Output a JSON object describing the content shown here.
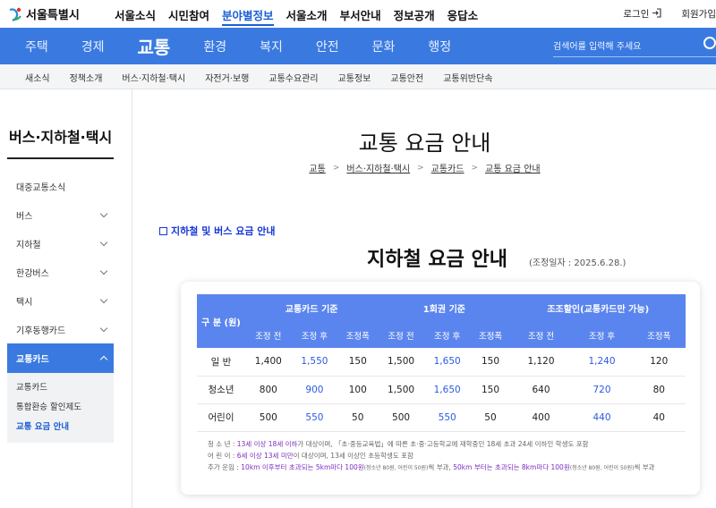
{
  "header": {
    "logo_text": "서울특별시",
    "top_nav": [
      "서울소식",
      "시민참여",
      "분야별정보",
      "서울소개",
      "부서안내",
      "정보공개",
      "응답소"
    ],
    "top_nav_active": 2,
    "login_label": "로그인",
    "signup_label": "회원가입"
  },
  "main_nav": {
    "items": [
      "주택",
      "경제",
      "교통",
      "환경",
      "복지",
      "안전",
      "문화",
      "행정"
    ],
    "active": 2,
    "search_placeholder": "검색어를 입력해 주세요"
  },
  "sub_nav": [
    "새소식",
    "정책소개",
    "버스·지하철·택시",
    "자전거·보행",
    "교통수요관리",
    "교통정보",
    "교통안전",
    "교통위반단속"
  ],
  "sidebar": {
    "title": "버스·지하철·택시",
    "items": [
      {
        "label": "대중교통소식",
        "has_chevron": false
      },
      {
        "label": "버스",
        "has_chevron": true
      },
      {
        "label": "지하철",
        "has_chevron": true
      },
      {
        "label": "한강버스",
        "has_chevron": true
      },
      {
        "label": "택시",
        "has_chevron": true
      },
      {
        "label": "기후동행카드",
        "has_chevron": true
      },
      {
        "label": "교통카드",
        "has_chevron": true,
        "active": true
      }
    ],
    "sub_items": [
      "교통카드",
      "통합환승 할인제도",
      "교통 요금 안내"
    ],
    "current_sub": "교통 요금 안내"
  },
  "content": {
    "page_title": "교통 요금 안내",
    "breadcrumb": [
      "교통",
      "버스·지하철·택시",
      "교통카드",
      "교통 요금 안내"
    ],
    "section_heading": "지하철 및 버스 요금 안내",
    "fare_title": "지하철 요금 안내",
    "adjust_date": "(조정일자 : 2025.6.28.)"
  },
  "fare_table": {
    "row_header": "구 분 (원)",
    "groups": [
      "교통카드 기준",
      "1회권 기준",
      "조조할인(교통카드만 가능)"
    ],
    "sub_headers": [
      "조정 전",
      "조정 후",
      "조정폭"
    ],
    "rows": [
      {
        "label": "일 반",
        "values": [
          "1,400",
          "1,550",
          "150",
          "1,500",
          "1,650",
          "150",
          "1,120",
          "1,240",
          "120"
        ]
      },
      {
        "label": "청소년",
        "values": [
          "800",
          "900",
          "100",
          "1,500",
          "1,650",
          "150",
          "640",
          "720",
          "80"
        ]
      },
      {
        "label": "어린이",
        "values": [
          "500",
          "550",
          "50",
          "500",
          "550",
          "50",
          "400",
          "440",
          "40"
        ]
      }
    ]
  },
  "notes": {
    "youth_prefix": "청 소 년 : ",
    "youth_hl": "13세 이상 18세 이하",
    "youth_rest": "가 대상이며, 「초·중등교육법」에 따른 초·중·고등학교에 재학중인 18세 초과 24세 이하인 학생도 포함",
    "child_prefix": "어 린 이 : ",
    "child_hl": "6세 이상 13세 미만",
    "child_rest": "이 대상이며, 13세 이상인 초등학생도 포함",
    "extra_prefix": "추가 운임 : ",
    "extra_hl1": "10km 이후부터 초과되는 5km마다 100원",
    "extra_small1": "(청소년 80원, 어린이 50원)",
    "extra_mid": "씩 부과, ",
    "extra_hl2": "50km 부터는 초과되는 8km마다 100원",
    "extra_small2": "(청소년 80원, 어린이 50원)",
    "extra_end": "씩 부과"
  }
}
